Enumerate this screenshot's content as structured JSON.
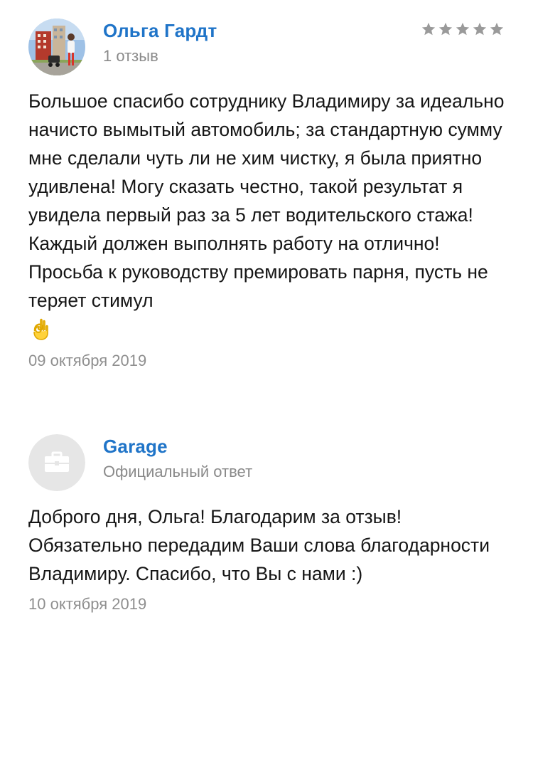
{
  "review": {
    "author": "Ольга Гардт",
    "author_meta": "1 отзыв",
    "rating": {
      "value": 0,
      "max": 5
    },
    "text": "Большое спасибо сотруднику Владимиру за идеально начисто вымытый автомобиль; за стандартную сумму мне сделали чуть ли не хим чистку, я была приятно удивлена! Могу сказать честно, такой результат я увидела первый раз за 5 лет водительского стажа! Каждый должен выполнять работу на отлично! Просьба к руководству премировать парня, пусть не теряет стимул",
    "emoji": "ok-hand",
    "date": "09 октября 2019"
  },
  "reply": {
    "author": "Garage",
    "author_meta": "Официальный ответ",
    "text": "Доброго дня, Ольга! Благодарим за отзыв! Обязательно передадим Ваши слова благодарности Владимиру. Спасибо, что Вы с нами :)",
    "date": "10 октября 2019"
  },
  "colors": {
    "link_blue": "#1f74c8",
    "muted_gray": "#8a8a8a",
    "star_gray": "#9a9a9a",
    "placeholder_avatar": "#e6e6e6"
  },
  "icons": {
    "avatar_placeholder": "briefcase-icon",
    "star": "star-icon"
  }
}
